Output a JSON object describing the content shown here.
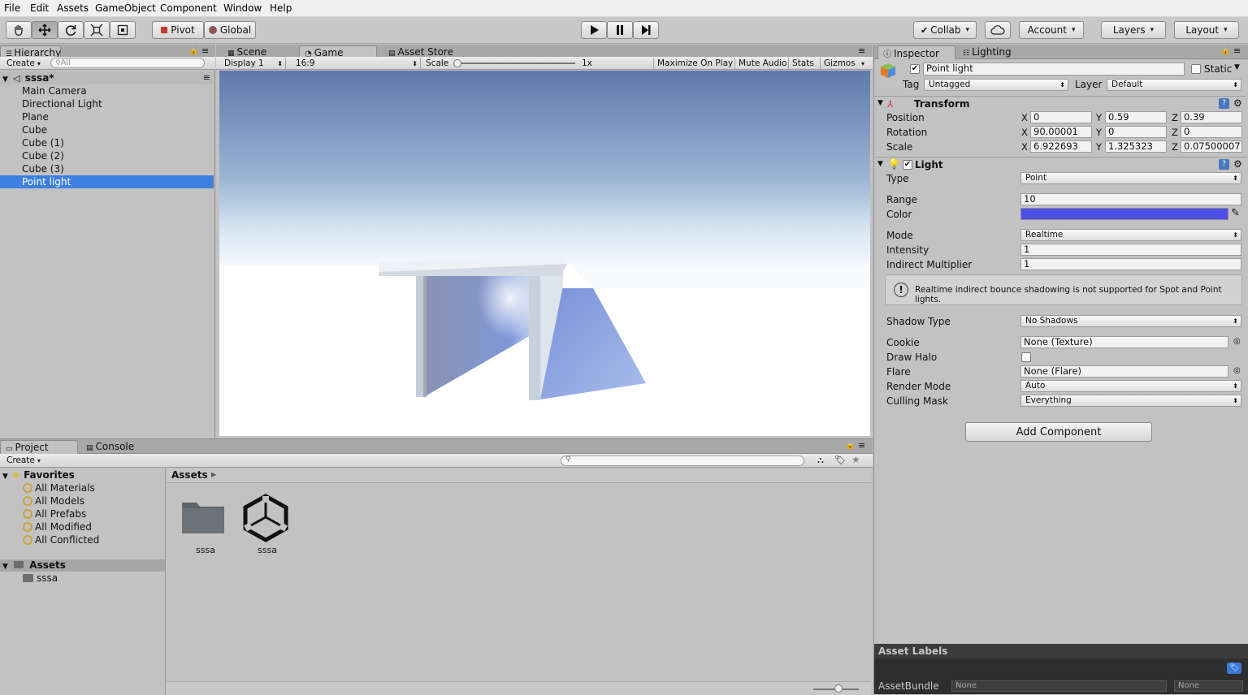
{
  "menu": [
    "File",
    "Edit",
    "Assets",
    "GameObject",
    "Component",
    "Window",
    "Help"
  ],
  "toolbar": {
    "pivot": "Pivot",
    "global": "Global",
    "collab": "Collab",
    "account": "Account",
    "layers": "Layers",
    "layout": "Layout"
  },
  "hierarchy": {
    "tab": "Hierarchy",
    "create": "Create",
    "search_placeholder": "All",
    "scene": "sssa*",
    "items": [
      "Main Camera",
      "Directional Light",
      "Plane",
      "Cube",
      "Cube (1)",
      "Cube (2)",
      "Cube (3)",
      "Point light"
    ],
    "selected_index": 7
  },
  "game": {
    "tabs": [
      "Scene",
      "Game",
      "Asset Store"
    ],
    "active_tab": "Game",
    "display": "Display 1",
    "aspect": "16:9",
    "scale_label": "Scale",
    "scale_value": "1x",
    "maximize": "Maximize On Play",
    "mute": "Mute Audio",
    "stats": "Stats",
    "gizmos": "Gizmos"
  },
  "inspector": {
    "tabs": [
      "Inspector",
      "Lighting"
    ],
    "object_name": "Point light",
    "static_label": "Static",
    "tag_label": "Tag",
    "tag_value": "Untagged",
    "layer_label": "Layer",
    "layer_value": "Default",
    "transform": {
      "title": "Transform",
      "position_label": "Position",
      "rotation_label": "Rotation",
      "scale_label": "Scale",
      "position": [
        "0",
        "0.59",
        "0.39"
      ],
      "rotation": [
        "90.00001",
        "0",
        "0"
      ],
      "scale": [
        "6.922693",
        "1.325323",
        "0.07500007"
      ]
    },
    "light": {
      "title": "Light",
      "type_label": "Type",
      "type_value": "Point",
      "range_label": "Range",
      "range_value": "10",
      "color_label": "Color",
      "color_value": "#4d4de8",
      "mode_label": "Mode",
      "mode_value": "Realtime",
      "intensity_label": "Intensity",
      "intensity_value": "1",
      "indirect_label": "Indirect Multiplier",
      "indirect_value": "1",
      "warning": "Realtime indirect bounce shadowing is not supported for Spot and Point lights.",
      "shadow_label": "Shadow Type",
      "shadow_value": "No Shadows",
      "cookie_label": "Cookie",
      "cookie_value": "None (Texture)",
      "halo_label": "Draw Halo",
      "flare_label": "Flare",
      "flare_value": "None (Flare)",
      "render_label": "Render Mode",
      "render_value": "Auto",
      "culling_label": "Culling Mask",
      "culling_value": "Everything"
    },
    "add_component": "Add Component",
    "asset_labels": "Asset Labels",
    "asset_bundle_label": "AssetBundle",
    "asset_bundle_value": "None",
    "asset_bundle_variant": "None"
  },
  "project": {
    "tabs": [
      "Project",
      "Console"
    ],
    "create": "Create",
    "favorites_title": "Favorites",
    "favorites": [
      "All Materials",
      "All Models",
      "All Prefabs",
      "All Modified",
      "All Conflicted"
    ],
    "assets_title": "Assets",
    "tree_child": "sssa",
    "breadcrumb": "Assets",
    "items": [
      {
        "name": "sssa",
        "icon": "folder-icon"
      },
      {
        "name": "sssa",
        "icon": "unity-scene-icon"
      }
    ]
  },
  "colors": {
    "selection": "#3d80df",
    "light_color": "#4d4de8"
  }
}
